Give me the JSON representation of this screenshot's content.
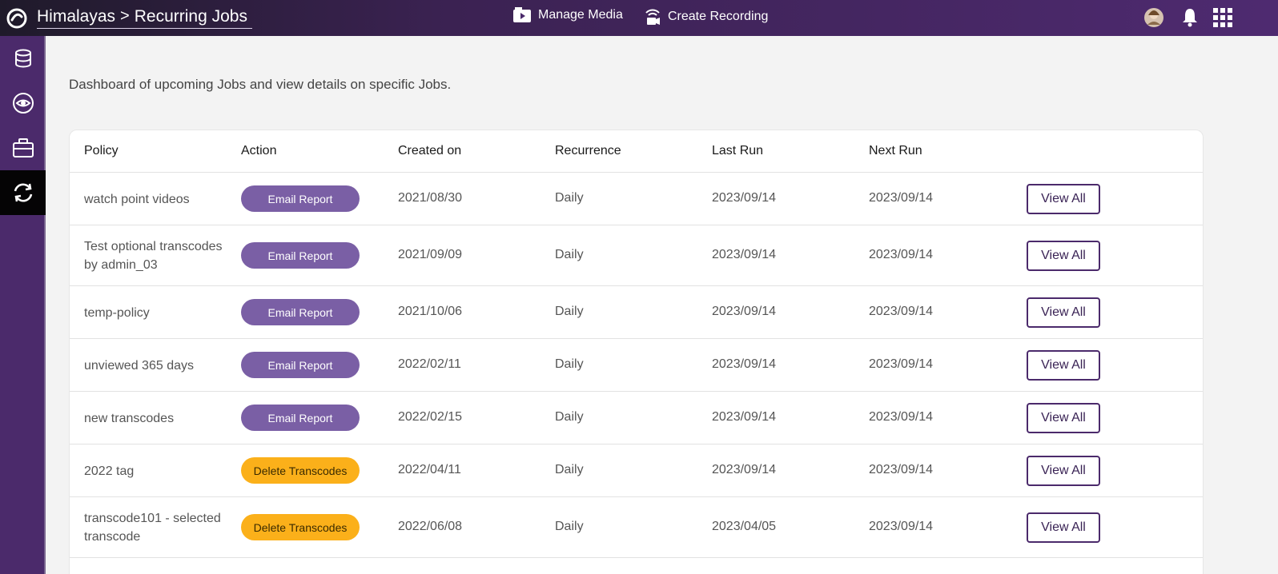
{
  "header": {
    "app_name": "Himalayas",
    "separator": ">",
    "page_title": "Recurring Jobs",
    "nav": [
      {
        "label": "Manage Media",
        "icon": "media-icon"
      },
      {
        "label": "Create Recording",
        "icon": "recording-icon"
      }
    ],
    "right_icons": [
      "avatar",
      "bell-icon",
      "apps-grid-icon"
    ]
  },
  "sidebar": {
    "items": [
      {
        "icon": "database-icon",
        "active": false
      },
      {
        "icon": "eye-icon",
        "active": false
      },
      {
        "icon": "briefcase-icon",
        "active": false
      },
      {
        "icon": "recurring-sync-icon",
        "active": true
      }
    ]
  },
  "description": "Dashboard of upcoming Jobs and view details on specific Jobs.",
  "table": {
    "columns": [
      "Policy",
      "Action",
      "Created on",
      "Recurrence",
      "Last Run",
      "Next Run"
    ],
    "view_label": "View All",
    "rows": [
      {
        "policy": "watch point videos",
        "action": "Email Report",
        "action_type": "email",
        "created": "2021/08/30",
        "recurrence": "Daily",
        "last_run": "2023/09/14",
        "next_run": "2023/09/14"
      },
      {
        "policy": "Test optional transcodes by admin_03",
        "action": "Email Report",
        "action_type": "email",
        "created": "2021/09/09",
        "recurrence": "Daily",
        "last_run": "2023/09/14",
        "next_run": "2023/09/14"
      },
      {
        "policy": "temp-policy",
        "action": "Email Report",
        "action_type": "email",
        "created": "2021/10/06",
        "recurrence": "Daily",
        "last_run": "2023/09/14",
        "next_run": "2023/09/14"
      },
      {
        "policy": "unviewed 365 days",
        "action": "Email Report",
        "action_type": "email",
        "created": "2022/02/11",
        "recurrence": "Daily",
        "last_run": "2023/09/14",
        "next_run": "2023/09/14"
      },
      {
        "policy": "new transcodes",
        "action": "Email Report",
        "action_type": "email",
        "created": "2022/02/15",
        "recurrence": "Daily",
        "last_run": "2023/09/14",
        "next_run": "2023/09/14"
      },
      {
        "policy": "2022 tag",
        "action": "Delete Transcodes",
        "action_type": "delete",
        "created": "2022/04/11",
        "recurrence": "Daily",
        "last_run": "2023/09/14",
        "next_run": "2023/09/14"
      },
      {
        "policy": "transcode101 - selected transcode",
        "action": "Delete Transcodes",
        "action_type": "delete",
        "created": "2022/06/08",
        "recurrence": "Daily",
        "last_run": "2023/04/05",
        "next_run": "2023/09/14"
      }
    ]
  },
  "colors": {
    "brand_purple": "#4b2a6b",
    "email_pill": "#7a5fa5",
    "delete_pill": "#fbb01a"
  }
}
